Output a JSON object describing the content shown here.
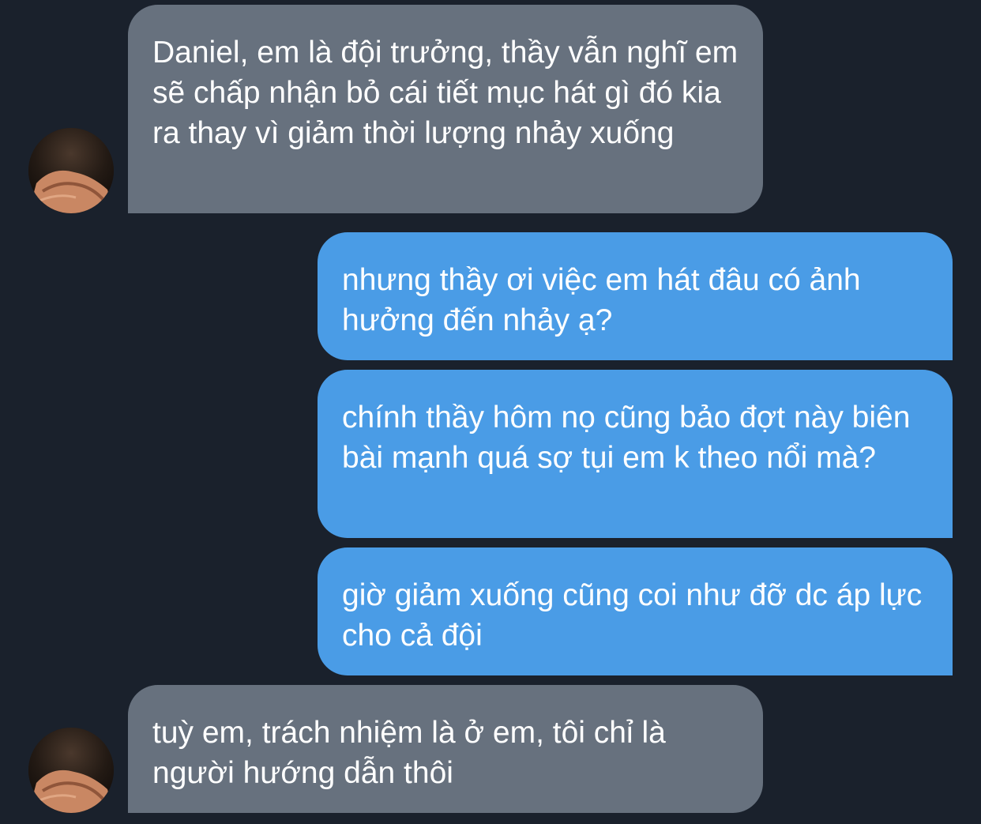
{
  "conversation": {
    "messages": [
      {
        "side": "incoming",
        "text": "Daniel, em là đội trưởng, thầy vẫn nghĩ em sẽ chấp nhận bỏ cái tiết mục hát gì đó kia ra thay vì giảm thời lượng nhảy xuống"
      },
      {
        "side": "outgoing",
        "text": "nhưng thầy ơi việc em hát đâu có ảnh hưởng đến nhảy ạ?"
      },
      {
        "side": "outgoing",
        "text": "chính thầy hôm nọ cũng bảo đợt này biên bài mạnh quá sợ tụi em k theo nổi mà?"
      },
      {
        "side": "outgoing",
        "text": "giờ giảm xuống cũng coi như đỡ dc áp lực cho cả đội"
      },
      {
        "side": "incoming",
        "text": "tuỳ em, trách nhiệm là ở em, tôi chỉ là người hướng dẫn thôi"
      }
    ]
  },
  "colors": {
    "background": "#1a212c",
    "incoming_bubble": "#67717e",
    "outgoing_bubble": "#4a9ce6",
    "text": "#ffffff"
  },
  "icons": {
    "avatar": "profile-photo-avatar"
  }
}
